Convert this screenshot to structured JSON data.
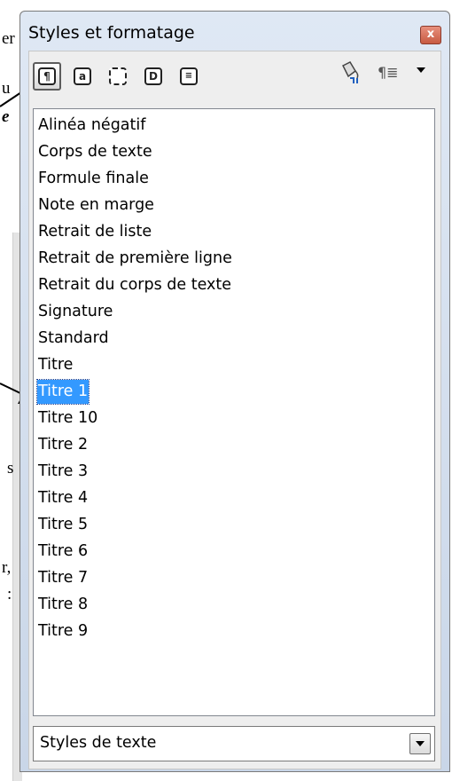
{
  "background": {
    "fragments": [
      "er",
      "u",
      "e",
      "s",
      "r,",
      ":"
    ]
  },
  "panel": {
    "title": "Styles et formatage",
    "close_label": "x",
    "toolbar": {
      "buttons": [
        {
          "name": "paragraph-styles",
          "glyph": "¶"
        },
        {
          "name": "character-styles",
          "glyph": "a"
        },
        {
          "name": "frame-styles",
          "glyph": ""
        },
        {
          "name": "page-styles",
          "glyph": "D"
        },
        {
          "name": "list-styles",
          "glyph": "≡"
        }
      ],
      "fill_format_icon": "fill-format-icon",
      "new_style_icon": "new-style-icon"
    },
    "styles": [
      "Alinéa négatif",
      "Corps de texte",
      "Formule finale",
      "Note en marge",
      "Retrait de liste",
      "Retrait de première ligne",
      "Retrait du corps de texte",
      "Signature",
      "Standard",
      "Titre",
      "Titre 1",
      "Titre 10",
      "Titre 2",
      "Titre 3",
      "Titre 4",
      "Titre 5",
      "Titre 6",
      "Titre 7",
      "Titre 8",
      "Titre 9"
    ],
    "selected_style": "Titre 1",
    "filter": {
      "value": "Styles de texte"
    }
  },
  "colors": {
    "selection": "#3399ff",
    "close_button": "#c75a42"
  }
}
